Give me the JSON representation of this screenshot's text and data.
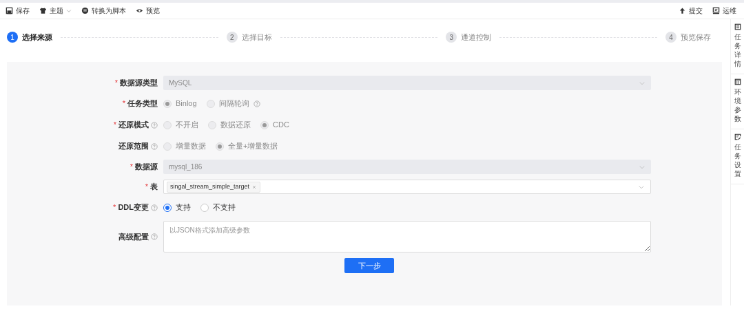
{
  "toolbar": {
    "left": [
      {
        "label": "保存"
      },
      {
        "label": "主题",
        "dropdown": true
      },
      {
        "label": "转换为脚本"
      },
      {
        "label": "预览"
      }
    ],
    "right": [
      {
        "label": "提交"
      },
      {
        "label": "运维"
      }
    ]
  },
  "steps": [
    {
      "number": "1",
      "label": "选择来源",
      "selected": true
    },
    {
      "number": "2",
      "label": "选择目标",
      "selected": false
    },
    {
      "number": "3",
      "label": "通道控制",
      "selected": false
    },
    {
      "number": "4",
      "label": "预览保存",
      "selected": false
    }
  ],
  "form": {
    "fields": [
      {
        "kind": "select",
        "label": "数据源类型",
        "required": "*",
        "help": false,
        "disabled": true,
        "value": "MySQL"
      },
      {
        "kind": "radio",
        "label": "任务类型",
        "required": "*",
        "help": false,
        "disabled": true,
        "options": [
          {
            "label": "Binlog",
            "selected": true,
            "help": false
          },
          {
            "label": "间隔轮询",
            "selected": false,
            "help": true
          }
        ]
      },
      {
        "kind": "radio",
        "label": "还原模式",
        "required": "*",
        "help": true,
        "disabled": true,
        "options": [
          {
            "label": "不开启",
            "selected": false,
            "help": false
          },
          {
            "label": "数据还原",
            "selected": false,
            "help": false
          },
          {
            "label": "CDC",
            "selected": true,
            "help": false
          }
        ]
      },
      {
        "kind": "radio",
        "label": "还原范围",
        "help": true,
        "disabled": true,
        "options": [
          {
            "label": "增量数据",
            "selected": false,
            "help": false
          },
          {
            "label": "全量+增量数据",
            "selected": true,
            "help": false
          }
        ]
      },
      {
        "kind": "select",
        "label": "数据源",
        "required": "*",
        "help": false,
        "disabled": true,
        "value": "mysql_186"
      },
      {
        "kind": "tags",
        "label": "表",
        "required": "*",
        "help": false,
        "disabled": false,
        "tags": [
          "singal_stream_simple_target"
        ]
      },
      {
        "kind": "radio",
        "label": "DDL变更",
        "required": "*",
        "help": true,
        "disabled": false,
        "options": [
          {
            "label": "支持",
            "selected": true,
            "help": false
          },
          {
            "label": "不支持",
            "selected": false,
            "help": false
          }
        ]
      },
      {
        "kind": "textarea",
        "label": "高级配置",
        "help": true,
        "disabled": false,
        "placeholder": "以JSON格式添加高级参数"
      }
    ],
    "submit": "下一步"
  },
  "sidebar": [
    {
      "label": "任务详情"
    },
    {
      "label": "环境参数"
    },
    {
      "label": "任务设置"
    }
  ]
}
